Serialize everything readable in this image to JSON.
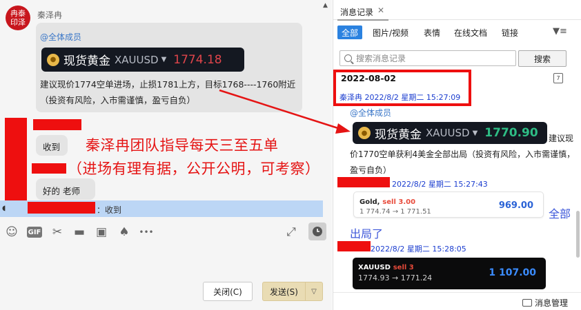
{
  "chat": {
    "avatar_text": "冉泰印泽",
    "sender": "秦泽冉",
    "message1": {
      "mention": "@全体成员",
      "ticker": {
        "name": "现货黄金",
        "code": "XAUUSD",
        "price": "1774.18"
      },
      "text": "建议现价1774空单进场，止损1781上方，目标1768----1760附近（投资有风险，入市需谨慎，盈亏自负）"
    },
    "message2": "收到",
    "message3": "好的  老师",
    "annotation_line1": "秦泽冉团队指导每天三至五单",
    "annotation_line2": "（进场有理有据，公开公明，可考察）",
    "quote_text": "：收到",
    "buttons": {
      "close": "关闭(C)",
      "send": "发送(S)"
    },
    "toolbar_labels": {
      "gif": "GIF",
      "more": "•••"
    }
  },
  "history": {
    "title": "消息记录",
    "filters": [
      {
        "label": "全部",
        "active": true
      },
      {
        "label": "图片/视频"
      },
      {
        "label": "表情"
      },
      {
        "label": "在线文档"
      },
      {
        "label": "链接"
      }
    ],
    "search_placeholder": "搜索消息记录",
    "search_button": "搜索",
    "date": "2022-08-02",
    "entry1_meta": "秦泽冉  2022/8/2 星期二 15:27:09",
    "entry1_mention": "@全体成员",
    "entry1_ticker": {
      "name": "现货黄金",
      "code": "XAUUSD",
      "price": "1770.90"
    },
    "entry1_text_a": "建议现",
    "entry1_text_b": "价1770空单获利4美金全部出局（投资有风险，入市需谨慎，盈亏自负）",
    "entry2_meta": "2022/8/2 星期二 15:27:43",
    "card1": {
      "label": "Gold,",
      "sell": "sell 3.00",
      "move": "1 774.74 → 1 771.51",
      "amount": "969.00"
    },
    "annotation_a": "全部",
    "annotation_b": "出局了",
    "entry3_meta": "2022/8/2 星期二 15:28:05",
    "card2": {
      "label": "XAUUSD",
      "sell": "sell 3",
      "move": "1774.93 → 1771.24",
      "amount": "1 107.00"
    },
    "manage": "消息管理"
  },
  "colors": {
    "accent": "#2b82e0",
    "annotation_red": "#e51414",
    "highlight_red": "#ee0f0f",
    "ticker_red": "#e0454b",
    "ticker_green": "#2ebd85"
  }
}
